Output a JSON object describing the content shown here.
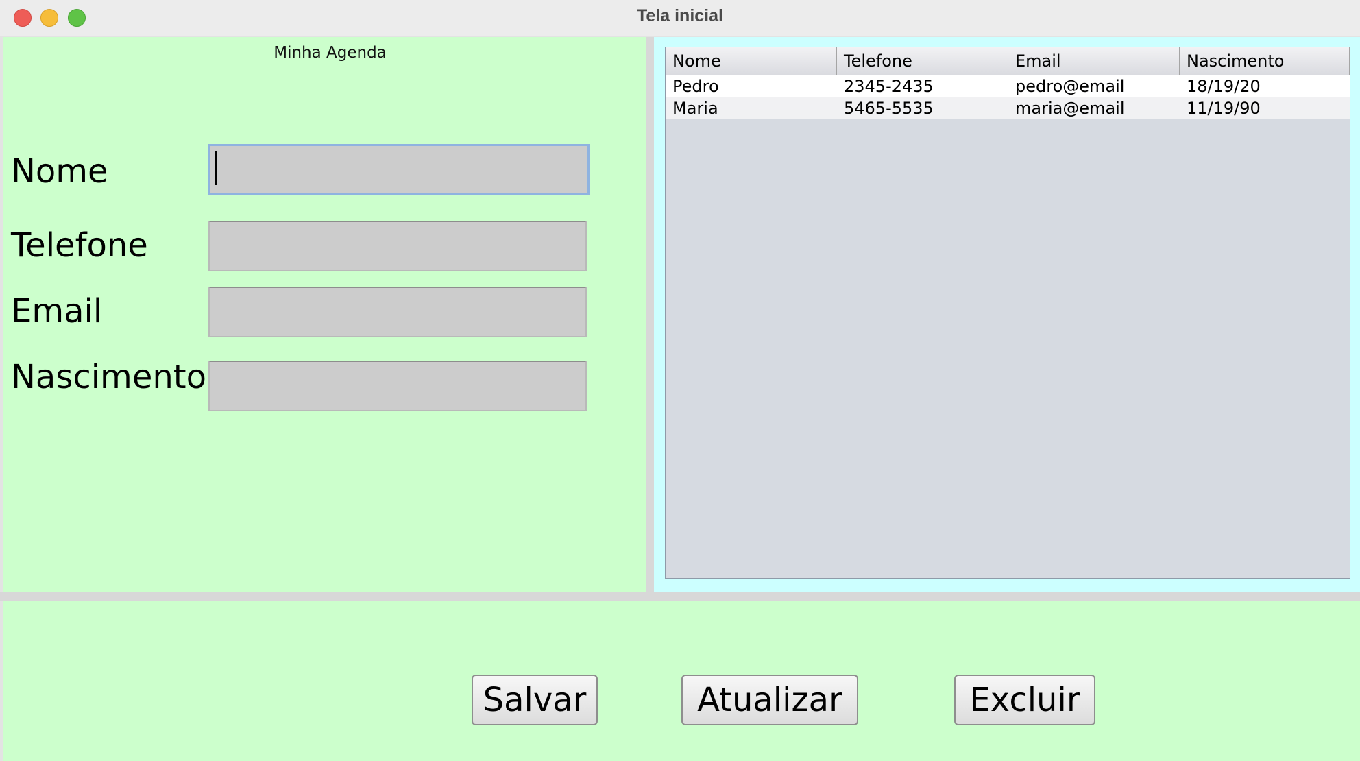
{
  "window": {
    "title": "Tela inicial"
  },
  "form": {
    "heading": "Minha Agenda",
    "fields": [
      {
        "label": "Nome",
        "value": "",
        "focused": true
      },
      {
        "label": "Telefone",
        "value": ""
      },
      {
        "label": "Email",
        "value": ""
      },
      {
        "label": "Nascimento",
        "value": ""
      }
    ]
  },
  "table": {
    "columns": [
      "Nome",
      "Telefone",
      "Email",
      "Nascimento"
    ],
    "rows": [
      [
        "Pedro",
        "2345-2435",
        "pedro@email",
        "18/19/20"
      ],
      [
        "Maria",
        "5465-5535",
        "maria@email",
        "11/19/90"
      ]
    ]
  },
  "buttons": {
    "save_label": "Salvar",
    "update_label": "Atualizar",
    "delete_label": "Excluir"
  },
  "colors": {
    "form_panel_bg": "#ccffcc",
    "table_panel_bg": "#ccffff",
    "input_bg": "#cccccc",
    "focus_border": "#8fb3e0"
  }
}
